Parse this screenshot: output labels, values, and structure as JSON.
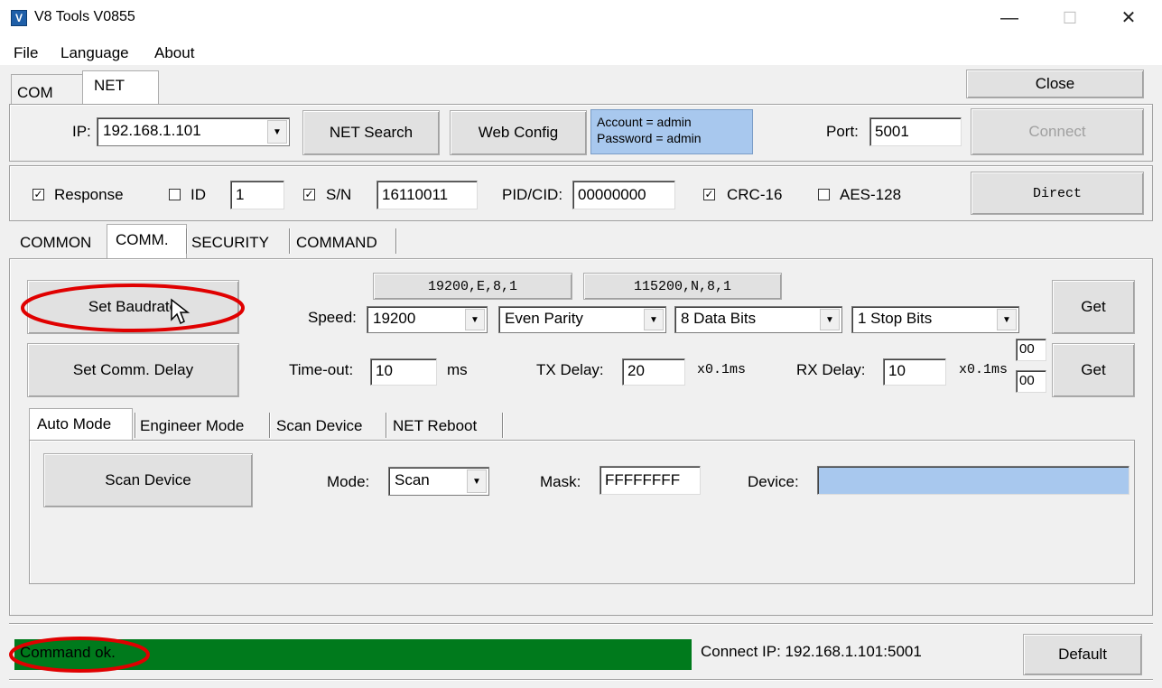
{
  "window": {
    "title": "V8 Tools V0855",
    "app_icon": "app-icon",
    "minimize": "—",
    "maximize": "☐",
    "close": "✕"
  },
  "menu": [
    "File",
    "Language",
    "About"
  ],
  "top_tabs": [
    "COM",
    "NET"
  ],
  "close_label": "Close",
  "net": {
    "ip_label": "IP:",
    "ip_value": "192.168.1.101",
    "search_label": "NET Search",
    "webconfig_label": "Web Config",
    "account_line1": "Account = admin",
    "account_line2": "Password = admin",
    "port_label": "Port:",
    "port_value": "5001",
    "connect_label": "Connect"
  },
  "options": {
    "response_label": "Response",
    "response_checked": true,
    "id_label": "ID",
    "id_checked": false,
    "id_value": "1",
    "sn_label": "S/N",
    "sn_checked": true,
    "sn_value": "16110011",
    "pidcid_label": "PID/CID:",
    "pidcid_value": "00000000",
    "crc_label": "CRC-16",
    "crc_checked": true,
    "aes_label": "AES-128",
    "aes_checked": false,
    "direct_label": "Direct"
  },
  "main_tabs": [
    "COMMON",
    "COMM.",
    "SECURITY",
    "COMMAND"
  ],
  "comm": {
    "preset1": "19200,E,8,1",
    "preset2": "115200,N,8,1",
    "set_baud_label": "Set Baudrate",
    "speed_label": "Speed:",
    "speed_value": "19200",
    "parity_value": "Even Parity",
    "databits_value": "8 Data Bits",
    "stopbits_value": "1 Stop Bits",
    "get1_label": "Get",
    "set_delay_label": "Set Comm. Delay",
    "timeout_label": "Time-out:",
    "timeout_value": "10",
    "ms_label": "ms",
    "txdelay_label": "TX Delay:",
    "txdelay_value": "20",
    "tx_unit": "x0.1ms",
    "rxdelay_label": "RX Delay:",
    "rxdelay_value": "10",
    "rx_unit": "x0.1ms",
    "small1": "00",
    "small2": "00",
    "get2_label": "Get"
  },
  "sub_tabs": [
    "Auto Mode",
    "Engineer Mode",
    "Scan Device",
    "NET Reboot"
  ],
  "auto": {
    "scan_label": "Scan Device",
    "mode_label": "Mode:",
    "mode_value": "Scan",
    "mask_label": "Mask:",
    "mask_value": "FFFFFFFF",
    "device_label": "Device:",
    "device_value": ""
  },
  "status": {
    "message": "Command ok.",
    "connect_ip": "Connect IP: 192.168.1.101:5001",
    "default_label": "Default",
    "bar_color": "#007a1c"
  },
  "colors": {
    "annotation": "#e00000",
    "account_bg": "#a8c8ee",
    "device_bg": "#a8c8ee"
  }
}
